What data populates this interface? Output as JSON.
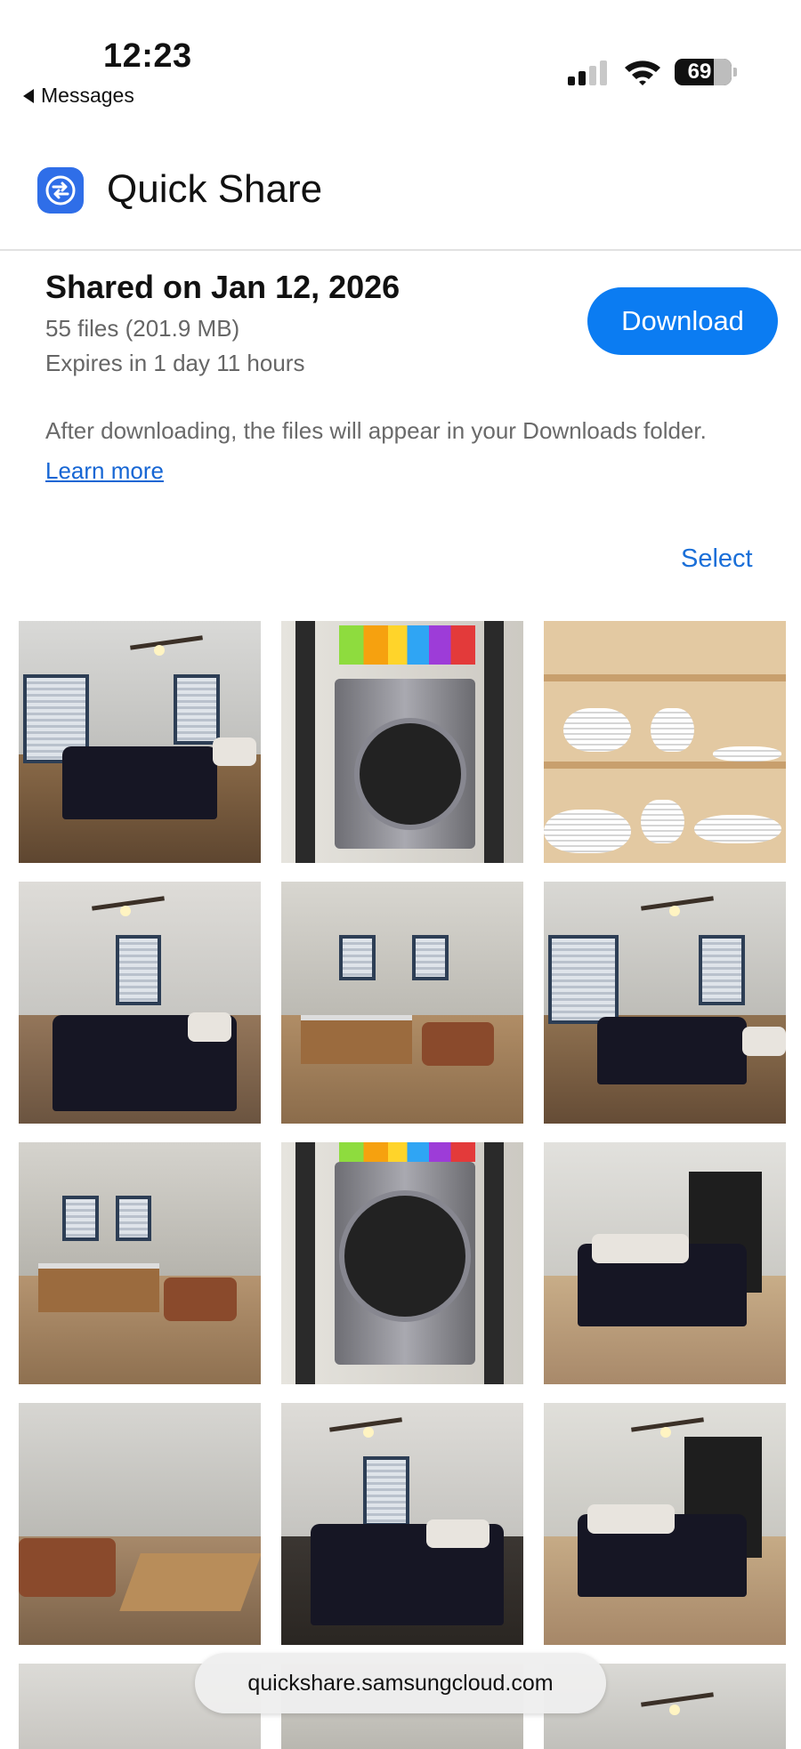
{
  "status_bar": {
    "time": "12:23",
    "back_label": "Messages",
    "battery": "69"
  },
  "header": {
    "title": "Quick Share"
  },
  "share": {
    "title": "Shared on Jan 12, 2026",
    "files": "55 files (201.9 MB)",
    "expires": "Expires in 1 day 11 hours",
    "download_label": "Download",
    "note": "After downloading, the files will appear in your Downloads folder. ",
    "learn_more": "Learn more"
  },
  "select_label": "Select",
  "url": "quickshare.samsungcloud.com",
  "colors": {
    "accent": "#0b7cf2",
    "link": "#1666d4",
    "app_icon": "#2f6ee8"
  }
}
